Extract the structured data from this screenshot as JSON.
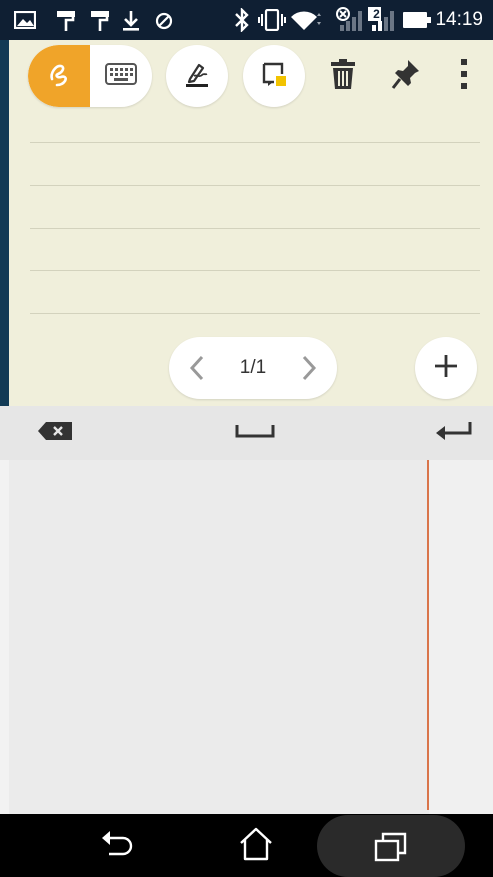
{
  "status_bar": {
    "time": "14:19",
    "sim2_label": "2",
    "left_icons": [
      "image-icon",
      "paint-roller-icon",
      "paint-roller-icon",
      "download-icon",
      "block-icon"
    ],
    "right_icons": [
      "bluetooth-icon",
      "vibrate-icon",
      "wifi-icon",
      "signal-sim1-icon",
      "signal-sim2-icon",
      "battery-icon"
    ]
  },
  "toolbar": {
    "mode_handwriting": "handwriting-mode-icon",
    "mode_keyboard": "keyboard-mode-icon",
    "pen": "pen-icon",
    "sticky_note": "sticky-note-icon",
    "delete": "trash-icon",
    "pin": "pin-icon",
    "more": "more-vertical-icon",
    "active_mode": "handwriting",
    "accent_color": "#f0a429"
  },
  "pager": {
    "label": "1/1"
  },
  "handwriting_keyboard": {
    "backspace": "backspace-icon",
    "space": "space-icon",
    "enter": "enter-icon",
    "divider_color": "#d9744a"
  },
  "nav_bar": {
    "back": "back-icon",
    "home": "home-icon",
    "recents": "recents-icon"
  }
}
